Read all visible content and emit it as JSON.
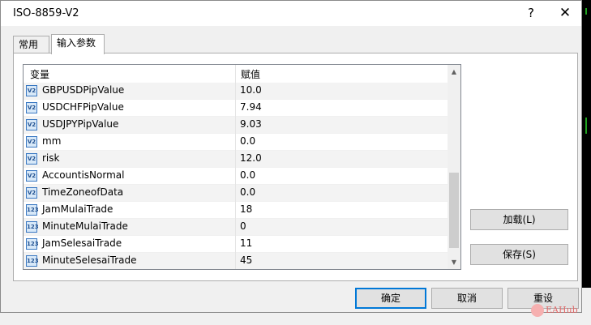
{
  "window": {
    "title": "ISO-8859-V2",
    "help_label": "?",
    "close_label": "✕"
  },
  "tabs": [
    {
      "label": "常用"
    },
    {
      "label": "输入参数"
    }
  ],
  "table": {
    "headers": {
      "variable": "变量",
      "value": "赋值"
    },
    "rows": [
      {
        "icon": "V2",
        "name": "GBPUSDPipValue",
        "value": "10.0"
      },
      {
        "icon": "V2",
        "name": "USDCHFPipValue",
        "value": "7.94"
      },
      {
        "icon": "V2",
        "name": "USDJPYPipValue",
        "value": "9.03"
      },
      {
        "icon": "V2",
        "name": "mm",
        "value": "0.0"
      },
      {
        "icon": "V2",
        "name": "risk",
        "value": "12.0"
      },
      {
        "icon": "V2",
        "name": "AccountisNormal",
        "value": "0.0"
      },
      {
        "icon": "V2",
        "name": "TimeZoneofData",
        "value": "0.0"
      },
      {
        "icon": "123",
        "name": "JamMulaiTrade",
        "value": "18"
      },
      {
        "icon": "123",
        "name": "MinuteMulaiTrade",
        "value": "0"
      },
      {
        "icon": "123",
        "name": "JamSelesaiTrade",
        "value": "11"
      },
      {
        "icon": "123",
        "name": "MinuteSelesaiTrade",
        "value": "45"
      }
    ]
  },
  "buttons": {
    "load": "加载(L)",
    "save": "保存(S)",
    "ok": "确定",
    "cancel": "取消",
    "reset": "重设"
  },
  "watermark": {
    "text": "EAHub"
  },
  "colors": {
    "accent": "#0078d7",
    "chart_green": "#1fa31f"
  }
}
